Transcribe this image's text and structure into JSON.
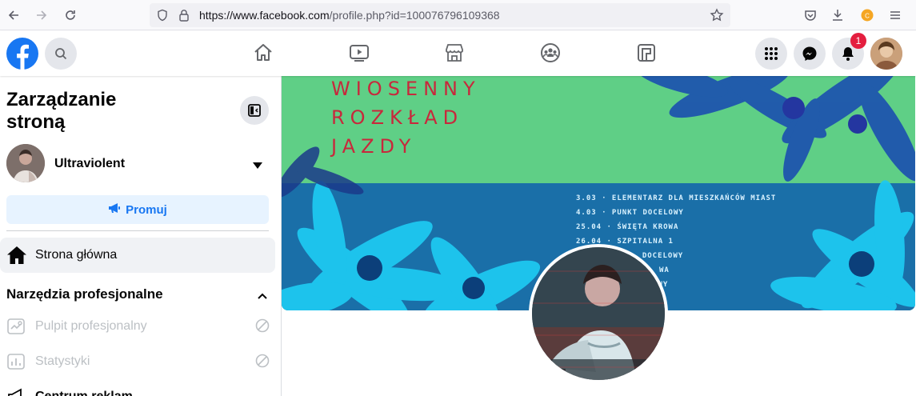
{
  "browser": {
    "url_prefix": "https://www.facebook.com",
    "url_path": "/profile.php?id=100076796109368"
  },
  "nav": {
    "notification_count": "1"
  },
  "sidebar": {
    "title": "Zarządzanie stroną",
    "page_name": "Ultraviolent",
    "promote_label": "Promuj",
    "home_label": "Strona główna",
    "section_title": "Narzędzia profesjonalne",
    "items": [
      {
        "label": "Pulpit profesjonalny"
      },
      {
        "label": "Statystyki"
      },
      {
        "label": "Centrum reklam"
      }
    ]
  },
  "cover": {
    "headline": [
      "WIOSENNY",
      "ROZKŁAD",
      "JAZDY"
    ],
    "events": [
      "3.03 · ELEMENTARZ DLA MIESZKAŃCÓW MIAST",
      "4.03 · PUNKT DOCELOWY",
      "25.04 · ŚWIĘTA KROWA",
      "26.04 · SZPITALNA 1",
      "· DOCELOWY",
      "WA",
      "OWY"
    ],
    "colors": {
      "top": "#5fcf86",
      "bottom": "#1a6fa8",
      "flowers": "#1ec8f0",
      "headline": "#c8283c"
    }
  }
}
